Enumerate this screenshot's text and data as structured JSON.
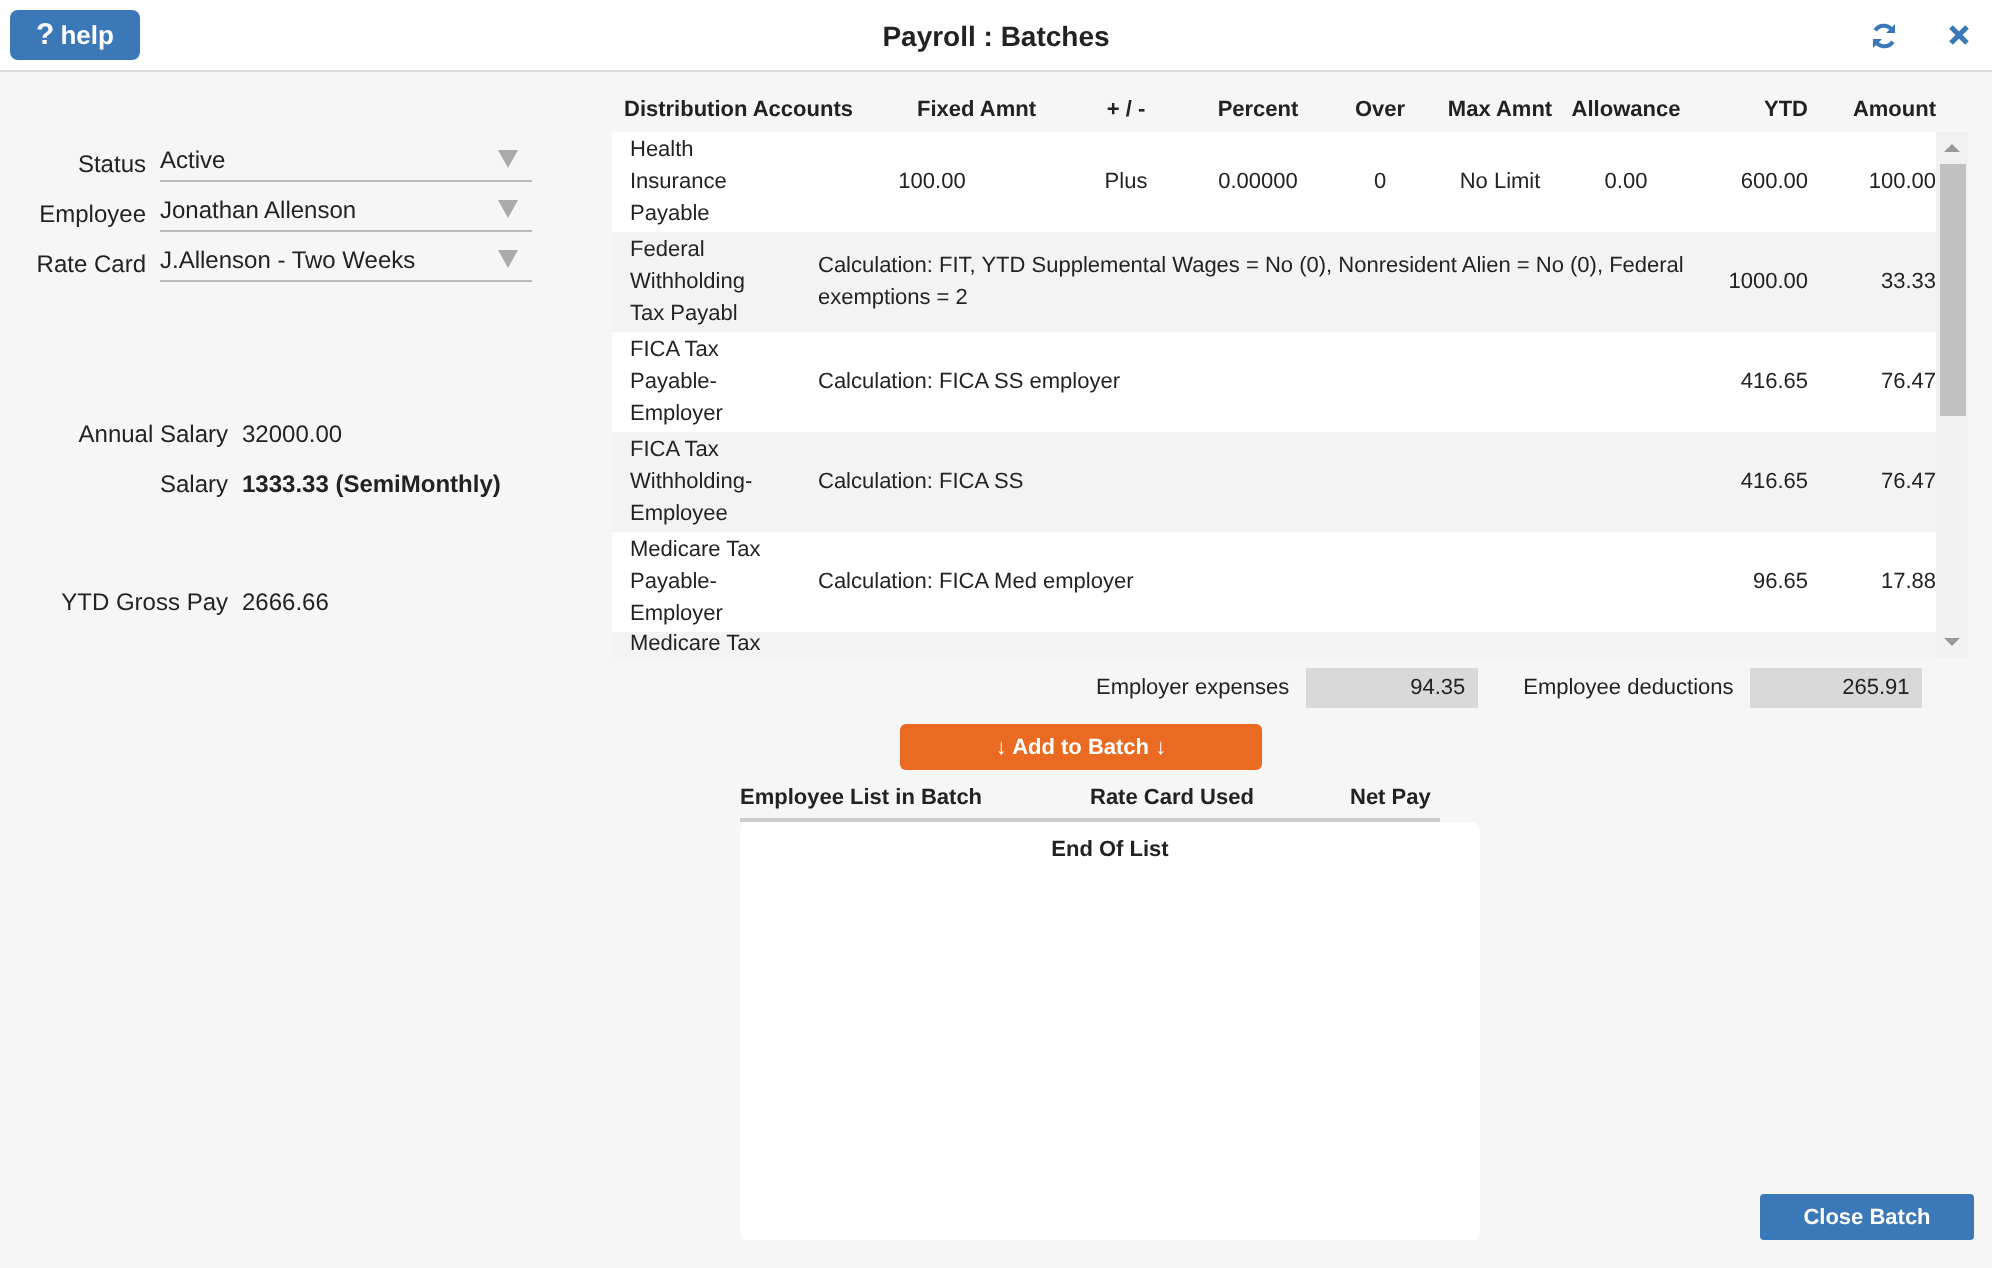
{
  "window": {
    "title": "Payroll : Batches"
  },
  "help_button": {
    "icon": "?",
    "label": "help"
  },
  "form": {
    "fields": [
      {
        "label": "Status",
        "value": "Active"
      },
      {
        "label": "Employee",
        "value": "Jonathan Allenson"
      },
      {
        "label": "Rate Card",
        "value": "J.Allenson - Two Weeks"
      }
    ]
  },
  "salary_info": [
    {
      "label": "Annual Salary",
      "value": "32000.00",
      "bold": false
    },
    {
      "label": "Salary",
      "value": "1333.33 (SemiMonthly)",
      "bold": true
    },
    {
      "label": "YTD Gross Pay",
      "value": "2666.66",
      "bold": false
    }
  ],
  "distribution": {
    "columns": [
      "Distribution Accounts",
      "Fixed Amnt",
      "+ / -",
      "Percent",
      "Over",
      "Max Amnt",
      "Allowance",
      "YTD",
      "Amount"
    ],
    "rows": [
      {
        "kind": "values",
        "account": "Health Insurance Payable",
        "values": [
          "100.00",
          "Plus",
          "0.00000",
          "0",
          "No Limit",
          "0.00",
          "600.00",
          "100.00"
        ]
      },
      {
        "kind": "calculation",
        "account": "Federal Withholding Tax Payabl",
        "calculation": "Calculation: FIT, YTD Supplemental Wages = No (0), Nonresident Alien = No (0), Federal exemptions = 2",
        "ytd": "1000.00",
        "amount": "33.33"
      },
      {
        "kind": "calculation",
        "account": "FICA Tax Payable-Employer",
        "calculation": "Calculation: FICA SS employer",
        "ytd": "416.65",
        "amount": "76.47"
      },
      {
        "kind": "calculation",
        "account": "FICA Tax Withholding-Employee",
        "calculation": "Calculation: FICA SS",
        "ytd": "416.65",
        "amount": "76.47"
      },
      {
        "kind": "calculation",
        "account": "Medicare Tax Payable-Employer",
        "calculation": "Calculation: FICA Med employer",
        "ytd": "96.65",
        "amount": "17.88"
      },
      {
        "kind": "cut",
        "account": "Medicare Tax"
      }
    ]
  },
  "totals": [
    {
      "label": "Employer expenses",
      "value": "94.35"
    },
    {
      "label": "Employee deductions",
      "value": "265.91"
    }
  ],
  "add_button": {
    "label": "↓ Add to Batch ↓"
  },
  "batch_list": {
    "columns": [
      "Employee List in Batch",
      "Rate Card Used",
      "Net Pay"
    ],
    "end_text": "End Of List"
  },
  "close_button": {
    "label": "Close Batch"
  }
}
